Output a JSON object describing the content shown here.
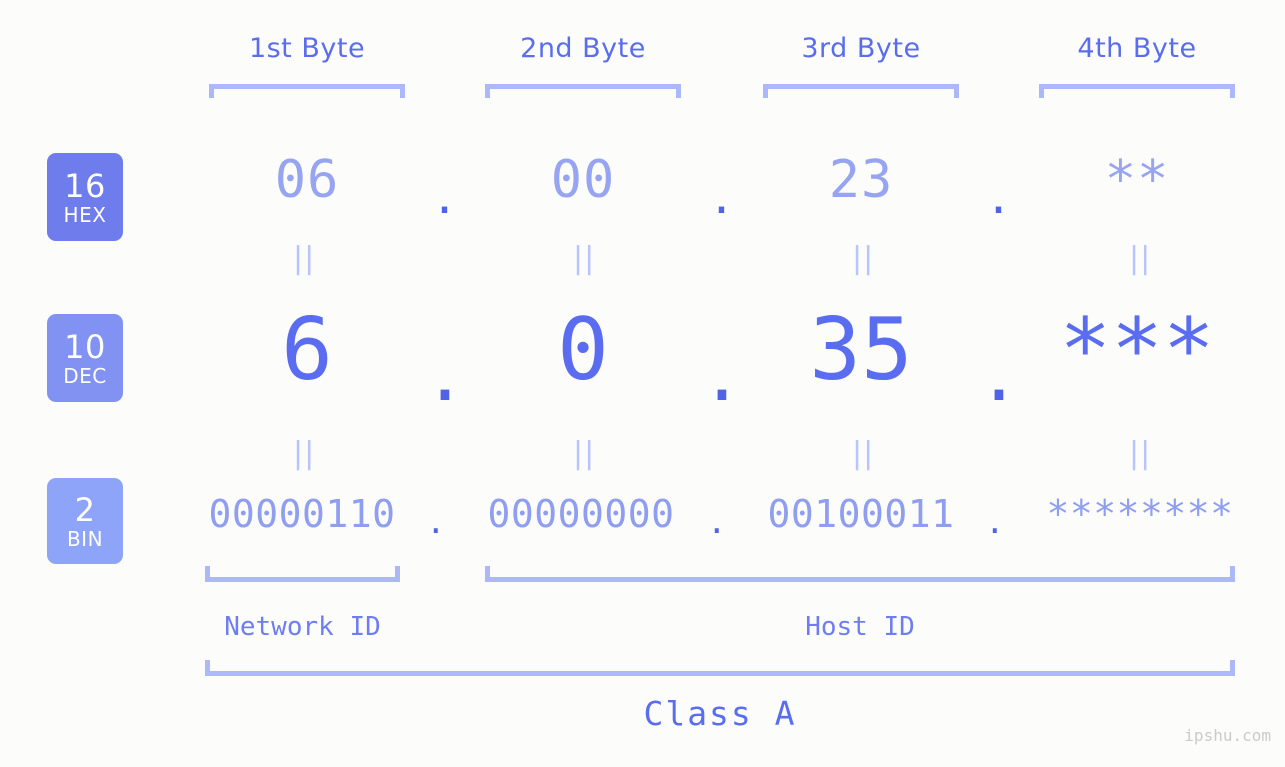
{
  "watermark": "ipshu.com",
  "byte_headers": [
    {
      "label": "1st Byte"
    },
    {
      "label": "2nd Byte"
    },
    {
      "label": "3rd Byte"
    },
    {
      "label": "4th Byte"
    }
  ],
  "radix_badges": [
    {
      "number": "16",
      "name": "HEX",
      "color": "#6e7cec"
    },
    {
      "number": "10",
      "name": "DEC",
      "color": "#8292f3"
    },
    {
      "number": "2",
      "name": "BIN",
      "color": "#8da4f8"
    }
  ],
  "rows": {
    "hex": {
      "radix": "16",
      "radix_name": "HEX",
      "values": [
        "06",
        "00",
        "23",
        "**"
      ],
      "separator": "."
    },
    "dec": {
      "radix": "10",
      "radix_name": "DEC",
      "values": [
        "6",
        "0",
        "35",
        "***"
      ],
      "separator": "."
    },
    "bin": {
      "radix": "2",
      "radix_name": "BIN",
      "values": [
        "00000110",
        "00000000",
        "00100011",
        "********"
      ],
      "separator": "."
    }
  },
  "equality_mark": "||",
  "sections": {
    "network_id": "Network ID",
    "host_id": "Host ID",
    "class": "Class A"
  },
  "colors": {
    "background": "#fcfdfa",
    "header_text": "#5a6cf0",
    "bracket": "#adb8fb",
    "hex_value": "#96a4f1",
    "dec_value": "#5a6cf0",
    "bin_value": "#8f9ef0",
    "separator_dot": "#4f63e8",
    "equality_mark": "#b9c4fb",
    "watermark": "#c9ccc9"
  }
}
